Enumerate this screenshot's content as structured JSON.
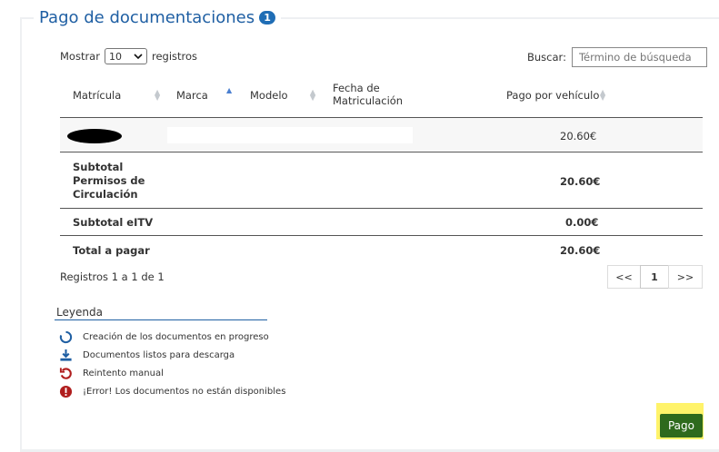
{
  "panel": {
    "title": "Pago de documentaciones",
    "badge": "1"
  },
  "controls": {
    "show_label": "Mostrar",
    "page_size": "10",
    "records_label": "registros",
    "search_label": "Buscar:",
    "search_placeholder": "Término de búsqueda"
  },
  "table": {
    "headers": {
      "matricula": "Matrícula",
      "marca": "Marca",
      "modelo": "Modelo",
      "fecha_line1": "Fecha de",
      "fecha_line2": "Matriculación",
      "pago": "Pago por vehículo"
    },
    "row": {
      "pago": "20.60€"
    },
    "subtotal_permisos": {
      "line1": "Subtotal",
      "line2": "Permisos de",
      "line3": "Circulación",
      "value": "20.60€"
    },
    "subtotal_eitv": {
      "label": "Subtotal eITV",
      "value": "0.00€"
    },
    "total": {
      "label": "Total a pagar",
      "value": "20.60€"
    }
  },
  "footer": {
    "info": "Registros 1 a 1 de 1",
    "pager_prev": "<<",
    "pager_current": "1",
    "pager_next": ">>"
  },
  "legend": {
    "title": "Leyenda",
    "items": [
      {
        "icon": "progress-circle-icon",
        "label": "Creación de los documentos en progreso"
      },
      {
        "icon": "download-icon",
        "label": "Documentos listos para descarga"
      },
      {
        "icon": "retry-icon",
        "label": "Reintento manual"
      },
      {
        "icon": "error-icon",
        "label": "¡Error! Los documentos no están disponibles"
      }
    ]
  },
  "actions": {
    "pay_label": "Pago"
  },
  "colors": {
    "accent_blue": "#1f5fa3",
    "pay_green": "#2e6a1d",
    "highlight_yellow": "#fff36a",
    "error_red": "#b01e1e"
  }
}
